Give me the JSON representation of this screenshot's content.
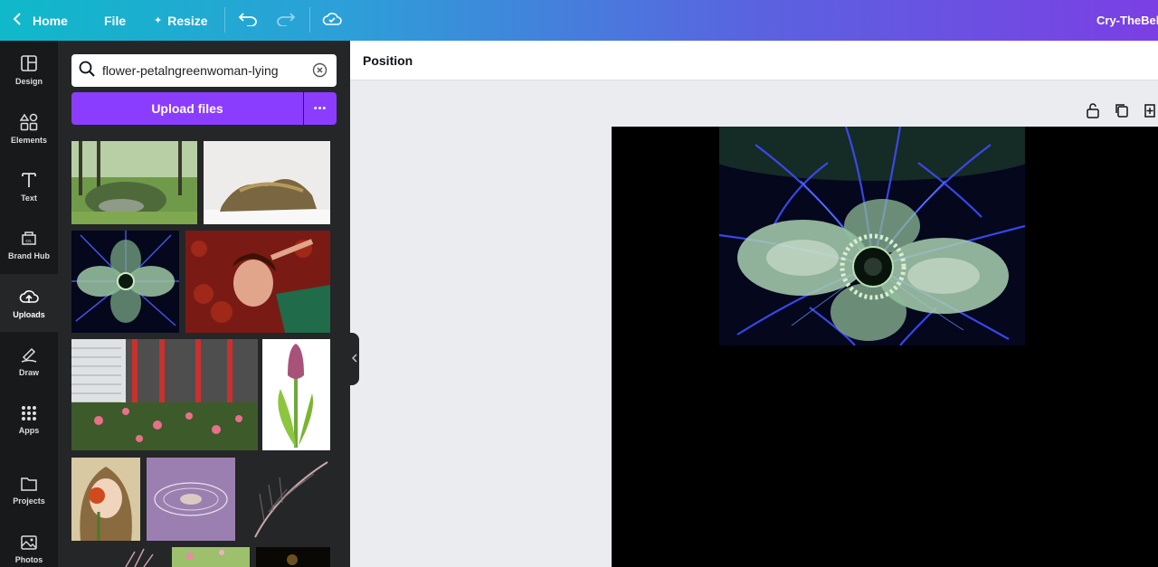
{
  "topbar": {
    "home_label": "Home",
    "file_label": "File",
    "resize_label": "Resize",
    "design_title": "Cry-TheBel",
    "icons": [
      "chevron-left-icon",
      "sparkle-icon",
      "undo-icon",
      "redo-icon",
      "cloud-saved-icon"
    ]
  },
  "rail": {
    "items": [
      {
        "label": "Design",
        "icon": "design-icon"
      },
      {
        "label": "Elements",
        "icon": "elements-icon"
      },
      {
        "label": "Text",
        "icon": "text-icon"
      },
      {
        "label": "Brand Hub",
        "icon": "brand-hub-icon"
      },
      {
        "label": "Uploads",
        "icon": "upload-cloud-icon",
        "active": true
      },
      {
        "label": "Draw",
        "icon": "draw-icon"
      },
      {
        "label": "Apps",
        "icon": "apps-icon"
      },
      {
        "label": "Projects",
        "icon": "folder-icon"
      },
      {
        "label": "Photos",
        "icon": "photo-icon"
      }
    ]
  },
  "panel": {
    "search": {
      "value": "flower-petalngreenwoman-lying"
    },
    "upload_label": "Upload files",
    "more_label": "•••"
  },
  "editor": {
    "position_label": "Position",
    "page_tool_icons": [
      "lock-icon",
      "duplicate-icon",
      "add-page-icon"
    ]
  },
  "colors": {
    "accent": "#8b3dff",
    "rail_bg": "#18191b",
    "panel_bg": "#252627",
    "canvas_bg": "#000000"
  }
}
